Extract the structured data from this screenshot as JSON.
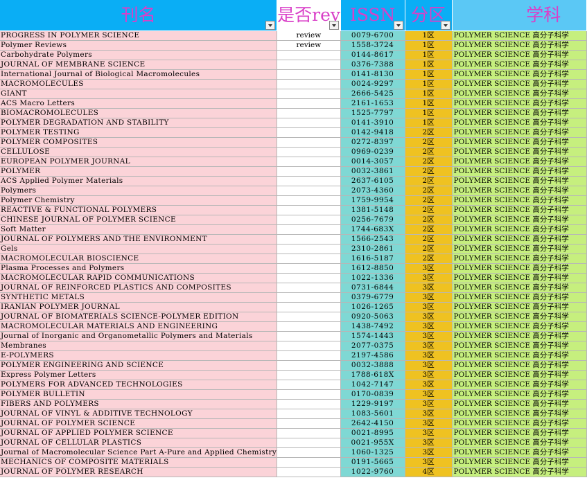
{
  "headers": {
    "name": "刊名",
    "review": "是否review",
    "issn": "ISSN",
    "zone": "分区",
    "subject": "学科"
  },
  "rows": [
    {
      "name": "PROGRESS IN POLYMER SCIENCE",
      "review": "review",
      "issn": "0079-6700",
      "zone": "1区",
      "subject": "POLYMER SCIENCE 高分子科学"
    },
    {
      "name": "Polymer Reviews",
      "review": "review",
      "issn": "1558-3724",
      "zone": "1区",
      "subject": "POLYMER SCIENCE 高分子科学"
    },
    {
      "name": "Carbohydrate Polymers",
      "review": "",
      "issn": "0144-8617",
      "zone": "1区",
      "subject": "POLYMER SCIENCE 高分子科学"
    },
    {
      "name": "JOURNAL OF MEMBRANE SCIENCE",
      "review": "",
      "issn": "0376-7388",
      "zone": "1区",
      "subject": "POLYMER SCIENCE 高分子科学"
    },
    {
      "name": "International Journal of Biological Macromolecules",
      "review": "",
      "issn": "0141-8130",
      "zone": "1区",
      "subject": "POLYMER SCIENCE 高分子科学"
    },
    {
      "name": "MACROMOLECULES",
      "review": "",
      "issn": "0024-9297",
      "zone": "1区",
      "subject": "POLYMER SCIENCE 高分子科学"
    },
    {
      "name": "GIANT",
      "review": "",
      "issn": "2666-5425",
      "zone": "1区",
      "subject": "POLYMER SCIENCE 高分子科学"
    },
    {
      "name": "ACS Macro Letters",
      "review": "",
      "issn": "2161-1653",
      "zone": "1区",
      "subject": "POLYMER SCIENCE 高分子科学"
    },
    {
      "name": "BIOMACROMOLECULES",
      "review": "",
      "issn": "1525-7797",
      "zone": "1区",
      "subject": "POLYMER SCIENCE 高分子科学"
    },
    {
      "name": "POLYMER DEGRADATION AND STABILITY",
      "review": "",
      "issn": "0141-3910",
      "zone": "1区",
      "subject": "POLYMER SCIENCE 高分子科学"
    },
    {
      "name": "POLYMER TESTING",
      "review": "",
      "issn": "0142-9418",
      "zone": "2区",
      "subject": "POLYMER SCIENCE 高分子科学"
    },
    {
      "name": "POLYMER COMPOSITES",
      "review": "",
      "issn": "0272-8397",
      "zone": "2区",
      "subject": "POLYMER SCIENCE 高分子科学"
    },
    {
      "name": "CELLULOSE",
      "review": "",
      "issn": "0969-0239",
      "zone": "2区",
      "subject": "POLYMER SCIENCE 高分子科学"
    },
    {
      "name": "EUROPEAN POLYMER JOURNAL",
      "review": "",
      "issn": "0014-3057",
      "zone": "2区",
      "subject": "POLYMER SCIENCE 高分子科学"
    },
    {
      "name": "POLYMER",
      "review": "",
      "issn": "0032-3861",
      "zone": "2区",
      "subject": "POLYMER SCIENCE 高分子科学"
    },
    {
      "name": "ACS Applied Polymer Materials",
      "review": "",
      "issn": "2637-6105",
      "zone": "2区",
      "subject": "POLYMER SCIENCE 高分子科学"
    },
    {
      "name": "Polymers",
      "review": "",
      "issn": "2073-4360",
      "zone": "2区",
      "subject": "POLYMER SCIENCE 高分子科学"
    },
    {
      "name": "Polymer Chemistry",
      "review": "",
      "issn": "1759-9954",
      "zone": "2区",
      "subject": "POLYMER SCIENCE 高分子科学"
    },
    {
      "name": "REACTIVE & FUNCTIONAL POLYMERS",
      "review": "",
      "issn": "1381-5148",
      "zone": "2区",
      "subject": "POLYMER SCIENCE 高分子科学"
    },
    {
      "name": "CHINESE JOURNAL OF POLYMER SCIENCE",
      "review": "",
      "issn": "0256-7679",
      "zone": "2区",
      "subject": "POLYMER SCIENCE 高分子科学"
    },
    {
      "name": "Soft Matter",
      "review": "",
      "issn": "1744-683X",
      "zone": "2区",
      "subject": "POLYMER SCIENCE 高分子科学"
    },
    {
      "name": "JOURNAL OF POLYMERS AND THE ENVIRONMENT",
      "review": "",
      "issn": "1566-2543",
      "zone": "2区",
      "subject": "POLYMER SCIENCE 高分子科学"
    },
    {
      "name": "Gels",
      "review": "",
      "issn": "2310-2861",
      "zone": "2区",
      "subject": "POLYMER SCIENCE 高分子科学"
    },
    {
      "name": "MACROMOLECULAR BIOSCIENCE",
      "review": "",
      "issn": "1616-5187",
      "zone": "2区",
      "subject": "POLYMER SCIENCE 高分子科学"
    },
    {
      "name": "Plasma Processes and Polymers",
      "review": "",
      "issn": "1612-8850",
      "zone": "3区",
      "subject": "POLYMER SCIENCE 高分子科学"
    },
    {
      "name": "MACROMOLECULAR RAPID COMMUNICATIONS",
      "review": "",
      "issn": "1022-1336",
      "zone": "3区",
      "subject": "POLYMER SCIENCE 高分子科学"
    },
    {
      "name": "JOURNAL OF REINFORCED PLASTICS AND COMPOSITES",
      "review": "",
      "issn": "0731-6844",
      "zone": "3区",
      "subject": "POLYMER SCIENCE 高分子科学"
    },
    {
      "name": "SYNTHETIC METALS",
      "review": "",
      "issn": "0379-6779",
      "zone": "3区",
      "subject": "POLYMER SCIENCE 高分子科学"
    },
    {
      "name": "IRANIAN POLYMER JOURNAL",
      "review": "",
      "issn": "1026-1265",
      "zone": "3区",
      "subject": "POLYMER SCIENCE 高分子科学"
    },
    {
      "name": "JOURNAL OF BIOMATERIALS SCIENCE-POLYMER EDITION",
      "review": "",
      "issn": "0920-5063",
      "zone": "3区",
      "subject": "POLYMER SCIENCE 高分子科学"
    },
    {
      "name": "MACROMOLECULAR MATERIALS AND ENGINEERING",
      "review": "",
      "issn": "1438-7492",
      "zone": "3区",
      "subject": "POLYMER SCIENCE 高分子科学"
    },
    {
      "name": "Journal of Inorganic and Organometallic Polymers and Materials",
      "review": "",
      "issn": "1574-1443",
      "zone": "3区",
      "subject": "POLYMER SCIENCE 高分子科学"
    },
    {
      "name": "Membranes",
      "review": "",
      "issn": "2077-0375",
      "zone": "3区",
      "subject": "POLYMER SCIENCE 高分子科学"
    },
    {
      "name": "E-POLYMERS",
      "review": "",
      "issn": "2197-4586",
      "zone": "3区",
      "subject": "POLYMER SCIENCE 高分子科学"
    },
    {
      "name": "POLYMER ENGINEERING AND SCIENCE",
      "review": "",
      "issn": "0032-3888",
      "zone": "3区",
      "subject": "POLYMER SCIENCE 高分子科学"
    },
    {
      "name": "Express Polymer Letters",
      "review": "",
      "issn": "1788-618X",
      "zone": "3区",
      "subject": "POLYMER SCIENCE 高分子科学"
    },
    {
      "name": "POLYMERS FOR ADVANCED TECHNOLOGIES",
      "review": "",
      "issn": "1042-7147",
      "zone": "3区",
      "subject": "POLYMER SCIENCE 高分子科学"
    },
    {
      "name": "POLYMER BULLETIN",
      "review": "",
      "issn": "0170-0839",
      "zone": "3区",
      "subject": "POLYMER SCIENCE 高分子科学"
    },
    {
      "name": "FIBERS AND POLYMERS",
      "review": "",
      "issn": "1229-9197",
      "zone": "3区",
      "subject": "POLYMER SCIENCE 高分子科学"
    },
    {
      "name": "JOURNAL OF VINYL & ADDITIVE TECHNOLOGY",
      "review": "",
      "issn": "1083-5601",
      "zone": "3区",
      "subject": "POLYMER SCIENCE 高分子科学"
    },
    {
      "name": "JOURNAL OF POLYMER SCIENCE",
      "review": "",
      "issn": "2642-4150",
      "zone": "3区",
      "subject": "POLYMER SCIENCE 高分子科学"
    },
    {
      "name": "JOURNAL OF APPLIED POLYMER SCIENCE",
      "review": "",
      "issn": "0021-8995",
      "zone": "3区",
      "subject": "POLYMER SCIENCE 高分子科学"
    },
    {
      "name": "JOURNAL OF CELLULAR PLASTICS",
      "review": "",
      "issn": "0021-955X",
      "zone": "3区",
      "subject": "POLYMER SCIENCE 高分子科学"
    },
    {
      "name": "Journal of Macromolecular Science Part A-Pure and Applied Chemistry",
      "review": "",
      "issn": "1060-1325",
      "zone": "3区",
      "subject": "POLYMER SCIENCE 高分子科学"
    },
    {
      "name": "MECHANICS OF COMPOSITE MATERIALS",
      "review": "",
      "issn": "0191-5665",
      "zone": "3区",
      "subject": "POLYMER SCIENCE 高分子科学"
    },
    {
      "name": "JOURNAL OF POLYMER RESEARCH",
      "review": "",
      "issn": "1022-9760",
      "zone": "4区",
      "subject": "POLYMER SCIENCE 高分子科学"
    }
  ]
}
